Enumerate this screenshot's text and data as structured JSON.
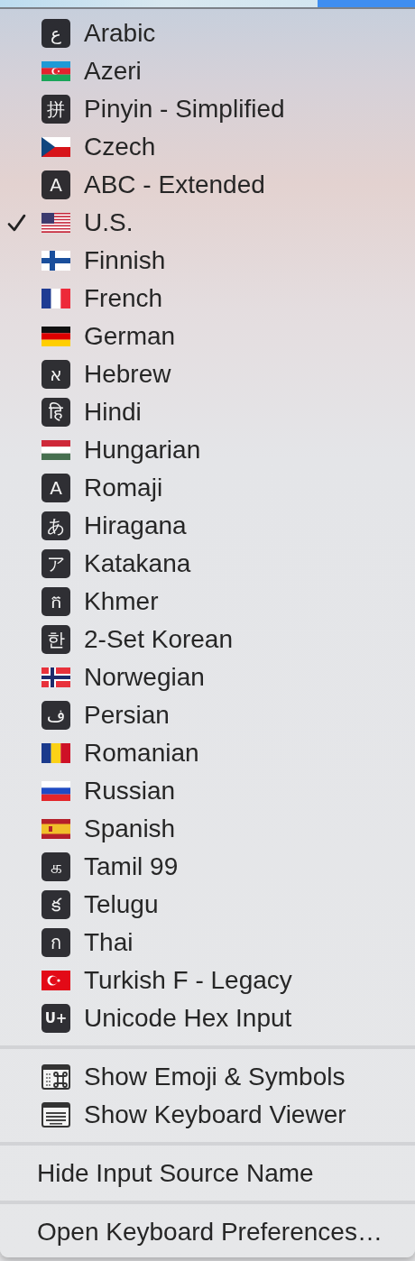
{
  "input_sources": [
    {
      "name": "Arabic",
      "kind": "glyph",
      "glyph": "ع",
      "checked": false
    },
    {
      "name": "Azeri",
      "kind": "az_flag",
      "checked": false
    },
    {
      "name": "Pinyin - Simplified",
      "kind": "glyph",
      "glyph": "拼",
      "checked": false
    },
    {
      "name": "Czech",
      "kind": "cz_flag",
      "checked": false
    },
    {
      "name": "ABC - Extended",
      "kind": "glyph",
      "glyph": "A",
      "checked": false
    },
    {
      "name": "U.S.",
      "kind": "us_flag",
      "checked": true
    },
    {
      "name": "Finnish",
      "kind": "fi_flag",
      "checked": false
    },
    {
      "name": "French",
      "kind": "fr_flag",
      "checked": false
    },
    {
      "name": "German",
      "kind": "de_flag",
      "checked": false
    },
    {
      "name": "Hebrew",
      "kind": "glyph",
      "glyph": "א",
      "checked": false
    },
    {
      "name": "Hindi",
      "kind": "glyph",
      "glyph": "हि",
      "checked": false
    },
    {
      "name": "Hungarian",
      "kind": "hu_flag",
      "checked": false
    },
    {
      "name": "Romaji",
      "kind": "glyph",
      "glyph": "A",
      "checked": false
    },
    {
      "name": "Hiragana",
      "kind": "glyph",
      "glyph": "あ",
      "checked": false
    },
    {
      "name": "Katakana",
      "kind": "glyph",
      "glyph": "ア",
      "checked": false
    },
    {
      "name": "Khmer",
      "kind": "glyph",
      "glyph": "ក",
      "checked": false
    },
    {
      "name": "2-Set Korean",
      "kind": "glyph",
      "glyph": "한",
      "checked": false
    },
    {
      "name": "Norwegian",
      "kind": "no_flag",
      "checked": false
    },
    {
      "name": "Persian",
      "kind": "glyph",
      "glyph": "ف",
      "checked": false
    },
    {
      "name": "Romanian",
      "kind": "ro_flag",
      "checked": false
    },
    {
      "name": "Russian",
      "kind": "ru_flag",
      "checked": false
    },
    {
      "name": "Spanish",
      "kind": "es_flag",
      "checked": false
    },
    {
      "name": "Tamil 99",
      "kind": "glyph",
      "glyph": "க",
      "checked": false
    },
    {
      "name": "Telugu",
      "kind": "glyph",
      "glyph": "క",
      "checked": false
    },
    {
      "name": "Thai",
      "kind": "glyph",
      "glyph": "ก",
      "checked": false
    },
    {
      "name": "Turkish F - Legacy",
      "kind": "tr_flag",
      "checked": false
    },
    {
      "name": "Unicode Hex Input",
      "kind": "glyph",
      "glyph": "U+",
      "checked": false
    }
  ],
  "viewers": [
    "Show Emoji & Symbols",
    "Show Keyboard Viewer"
  ],
  "options": [
    "Hide Input Source Name"
  ],
  "preferences": [
    "Open Keyboard Preferences…"
  ]
}
